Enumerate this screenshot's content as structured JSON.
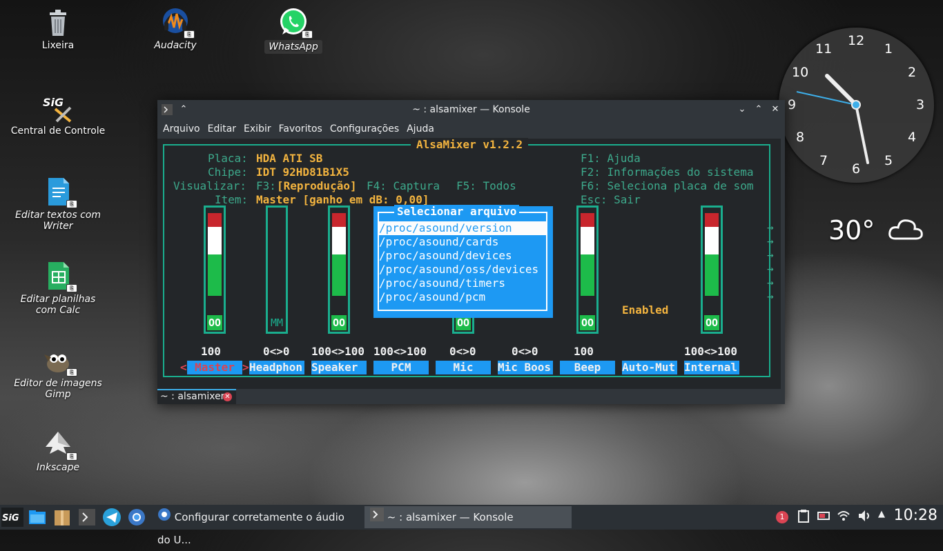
{
  "desktop": {
    "icons": [
      {
        "label": "Lixeira",
        "icon": "trash-icon"
      },
      {
        "label": "Audacity",
        "icon": "audacity-icon"
      },
      {
        "label": "WhatsApp",
        "icon": "whatsapp-icon"
      },
      {
        "label": "Central de Controle",
        "icon": "control-center-icon"
      },
      {
        "label": "Editar textos com Writer",
        "icon": "writer-icon"
      },
      {
        "label": "Editar planilhas com Calc",
        "icon": "calc-icon"
      },
      {
        "label": "Editor de imagens Gimp",
        "icon": "gimp-icon"
      },
      {
        "label": "Inkscape",
        "icon": "inkscape-icon"
      }
    ]
  },
  "window": {
    "title": "~ : alsamixer — Konsole",
    "menu": [
      "Arquivo",
      "Editar",
      "Exibir",
      "Favoritos",
      "Configurações",
      "Ajuda"
    ],
    "tab_label": "~ : alsamixer"
  },
  "alsamixer": {
    "header": "AlsaMixer v1.2.2",
    "card_label": "Placa:",
    "card_value": "HDA ATI SB",
    "chip_label": "Chipe:",
    "chip_value": "IDT 92HD81B1X5",
    "view_label": "Visualizar:",
    "view_f3": "F3:",
    "view_f3_value": "[Reprodução]",
    "view_f4": "F4: Captura",
    "view_f5": "F5: Todos",
    "item_label": "Item:",
    "item_value": "Master [ganho em dB: 0,00]",
    "help": [
      "F1: Ajuda",
      "F2: Informações do sistema",
      "F6: Seleciona placa de som",
      "Esc: Sair"
    ],
    "channels": [
      {
        "name": "Master",
        "volume": "100",
        "level": 1.0,
        "meter": "OO"
      },
      {
        "name": "Headphon",
        "volume": "0<>0",
        "level": 0.0,
        "meter": "MM"
      },
      {
        "name": "Speaker",
        "volume": "100<>100",
        "level": 1.0,
        "meter": "OO"
      },
      {
        "name": "PCM",
        "volume": "100<>100",
        "level": 1.0,
        "meter": ""
      },
      {
        "name": "Mic",
        "volume": "0<>0",
        "level": 0.0,
        "meter": "OO"
      },
      {
        "name": "Mic Boos",
        "volume": "0<>0",
        "level": 0.0,
        "meter": ""
      },
      {
        "name": "Beep",
        "volume": "100",
        "level": 1.0,
        "meter": "OO"
      },
      {
        "name": "Auto-Mut",
        "volume": "",
        "level": 0.0,
        "meter": "",
        "state": "Enabled"
      },
      {
        "name": "Internal",
        "volume": "100<>100",
        "level": 1.0,
        "meter": "OO"
      }
    ],
    "arrow_left": "<",
    "arrow_right": ">",
    "dialog": {
      "title": "Selecionar arquivo",
      "items": [
        "/proc/asound/version",
        "/proc/asound/cards",
        "/proc/asound/devices",
        "/proc/asound/oss/devices",
        "/proc/asound/timers",
        "/proc/asound/pcm"
      ],
      "selected": 0
    }
  },
  "clock_widget": {
    "numbers": [
      "12",
      "1",
      "2",
      "3",
      "4",
      "5",
      "6",
      "7",
      "8",
      "9",
      "10",
      "11"
    ]
  },
  "weather": {
    "temperature": "30°",
    "icon": "cloud-icon"
  },
  "taskbar": {
    "tasks": [
      {
        "label": "Configurar corretamente o áudio do U...",
        "icon": "chrome-icon"
      },
      {
        "label": "~ : alsamixer — Konsole",
        "icon": "konsole-icon"
      }
    ],
    "notification_count": "1",
    "time": "10:28"
  },
  "colors": {
    "accent": "#1d99f3",
    "teal": "#1aae8e",
    "gold": "#f3b43f",
    "red": "#da4453",
    "green": "#1dbb4a"
  }
}
